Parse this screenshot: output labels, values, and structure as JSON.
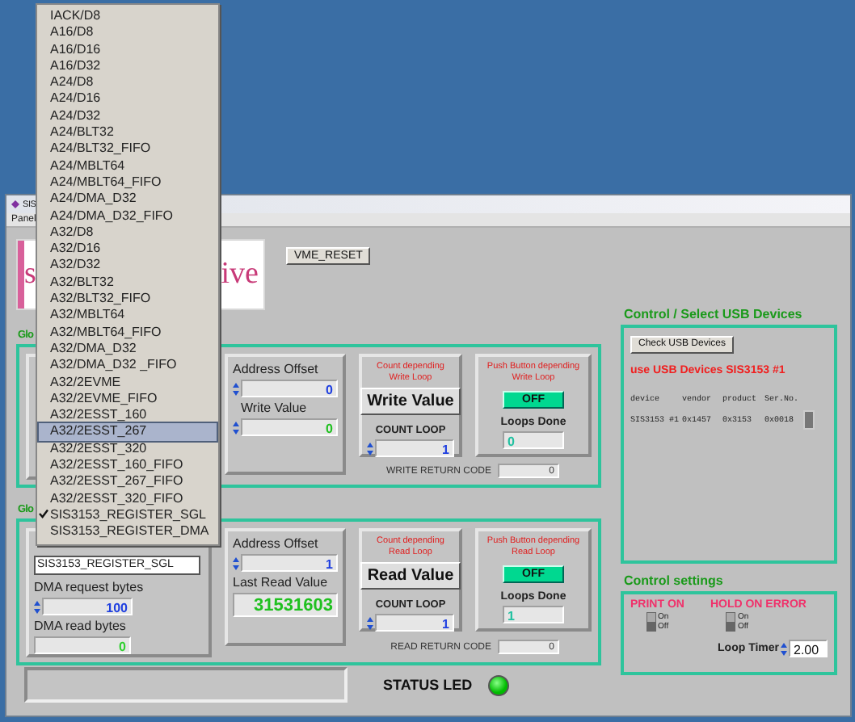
{
  "window": {
    "title": "SIS",
    "menu": [
      "Panel"
    ]
  },
  "logo": {
    "left_text": "s",
    "right_text": "ive"
  },
  "vme_reset": "VME_RESET",
  "groups": [
    {
      "kind": "write",
      "title": "Glo",
      "address_label": "Address Offset",
      "address_value": "0",
      "value_label": "Write Value",
      "value": "0",
      "count_title": "Count depending Write Loop",
      "action_button": "Write Value",
      "count_label": "COUNT LOOP",
      "count_value": "1",
      "push_title": "Push Button depending Write Loop",
      "push_button": {
        "label": "OFF",
        "on": false
      },
      "loops_label": "Loops Done",
      "loops_value": "0",
      "return_label": "WRITE RETURN CODE",
      "return_value": "0"
    },
    {
      "kind": "read",
      "title": "Glo",
      "mode": "SIS3153_REGISTER_SGL",
      "dma_request_label": "DMA request bytes",
      "dma_request_value": "100",
      "dma_read_label": "DMA read bytes",
      "dma_read_value": "0",
      "address_label": "Address Offset",
      "address_value": "1",
      "value_label": "Last Read Value",
      "value": "31531603",
      "count_title": "Count depending Read Loop",
      "action_button": "Read Value",
      "count_label": "COUNT LOOP",
      "count_value": "1",
      "push_title": "Push Button depending Read Loop",
      "push_button": {
        "label": "OFF",
        "on": false
      },
      "loops_label": "Loops Done",
      "loops_value": "1",
      "return_label": "READ RETURN CODE",
      "return_value": "0"
    }
  ],
  "usb": {
    "title": "Control / Select USB Devices",
    "check_button": "Check USB Devices",
    "status": "use USB Devices SIS3153 #1",
    "columns": [
      "device",
      "vendor",
      "product",
      "Ser.No."
    ],
    "rows": [
      [
        "SIS3153 #1",
        "0x1457",
        "0x3153",
        "0x0018"
      ]
    ]
  },
  "settings": {
    "title": "Control settings",
    "toggles": [
      {
        "label": "PRINT ON",
        "on_label": "On",
        "off_label": "Off",
        "on": false
      },
      {
        "label": "HOLD ON ERROR",
        "on_label": "On",
        "off_label": "Off",
        "on": false
      }
    ],
    "timer_label": "Loop Timer",
    "timer_value": "2.00"
  },
  "status_bar": {
    "led_label": "STATUS LED",
    "led_on": true
  },
  "dropdown": {
    "items": [
      {
        "label": "IACK/D8",
        "selected": false,
        "checked": false
      },
      {
        "label": "A16/D8",
        "selected": false,
        "checked": false
      },
      {
        "label": "A16/D16",
        "selected": false,
        "checked": false
      },
      {
        "label": "A16/D32",
        "selected": false,
        "checked": false
      },
      {
        "label": "A24/D8",
        "selected": false,
        "checked": false
      },
      {
        "label": "A24/D16",
        "selected": false,
        "checked": false
      },
      {
        "label": "A24/D32",
        "selected": false,
        "checked": false
      },
      {
        "label": "A24/BLT32",
        "selected": false,
        "checked": false
      },
      {
        "label": "A24/BLT32_FIFO",
        "selected": false,
        "checked": false
      },
      {
        "label": "A24/MBLT64",
        "selected": false,
        "checked": false
      },
      {
        "label": "A24/MBLT64_FIFO",
        "selected": false,
        "checked": false
      },
      {
        "label": "A24/DMA_D32",
        "selected": false,
        "checked": false
      },
      {
        "label": "A24/DMA_D32_FIFO",
        "selected": false,
        "checked": false
      },
      {
        "label": "A32/D8",
        "selected": false,
        "checked": false
      },
      {
        "label": "A32/D16",
        "selected": false,
        "checked": false
      },
      {
        "label": "A32/D32",
        "selected": false,
        "checked": false
      },
      {
        "label": "A32/BLT32",
        "selected": false,
        "checked": false
      },
      {
        "label": "A32/BLT32_FIFO",
        "selected": false,
        "checked": false
      },
      {
        "label": "A32/MBLT64",
        "selected": false,
        "checked": false
      },
      {
        "label": "A32/MBLT64_FIFO",
        "selected": false,
        "checked": false
      },
      {
        "label": "A32/DMA_D32",
        "selected": false,
        "checked": false
      },
      {
        "label": "A32/DMA_D32 _FIFO",
        "selected": false,
        "checked": false
      },
      {
        "label": "A32/2EVME",
        "selected": false,
        "checked": false
      },
      {
        "label": "A32/2EVME_FIFO",
        "selected": false,
        "checked": false
      },
      {
        "label": "A32/2ESST_160",
        "selected": false,
        "checked": false
      },
      {
        "label": "A32/2ESST_267",
        "selected": true,
        "checked": false
      },
      {
        "label": "A32/2ESST_320",
        "selected": false,
        "checked": false
      },
      {
        "label": "A32/2ESST_160_FIFO",
        "selected": false,
        "checked": false
      },
      {
        "label": "A32/2ESST_267_FIFO",
        "selected": false,
        "checked": false
      },
      {
        "label": "A32/2ESST_320_FIFO",
        "selected": false,
        "checked": false
      },
      {
        "label": "SIS3153_REGISTER_SGL",
        "selected": false,
        "checked": true
      },
      {
        "label": "SIS3153_REGISTER_DMA",
        "selected": false,
        "checked": false
      }
    ]
  }
}
